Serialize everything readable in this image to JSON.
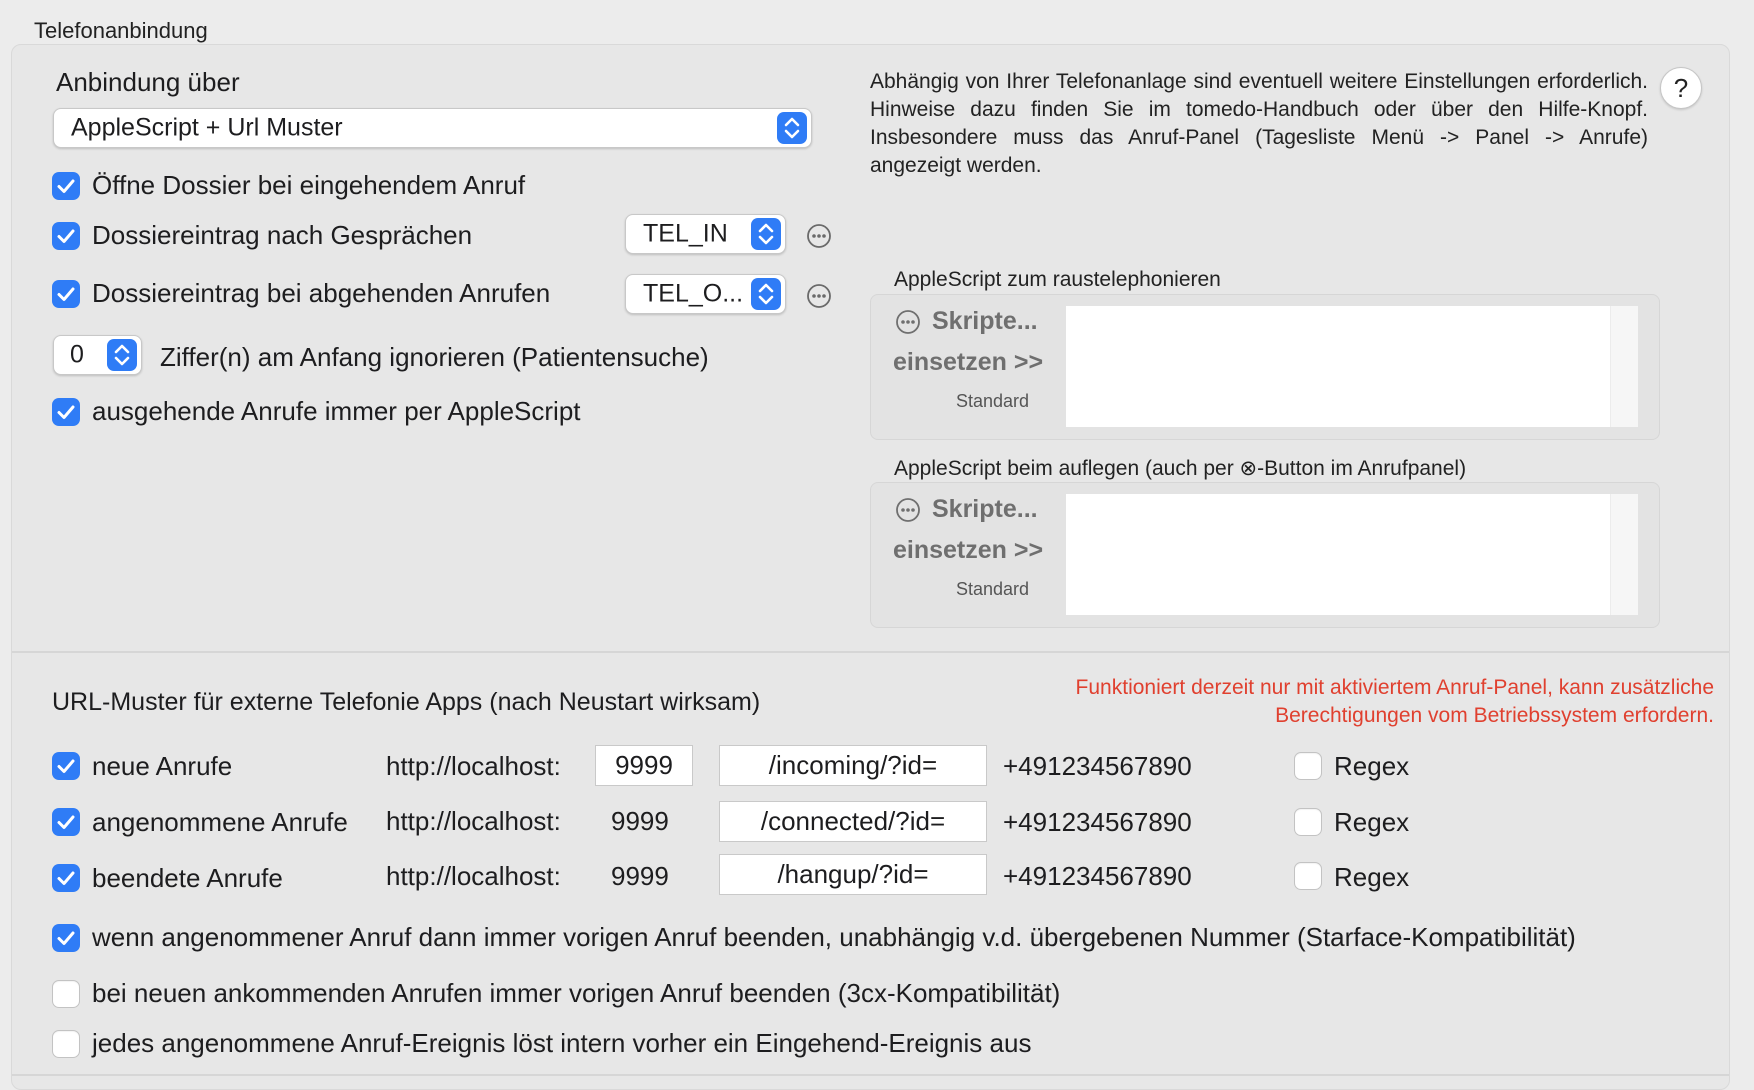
{
  "section_title": "Telefonanbindung",
  "connection": {
    "label": "Anbindung über",
    "selected": "AppleScript + Url Muster"
  },
  "options": {
    "open_dossier": "Öffne Dossier bei eingehendem Anruf",
    "entry_after_call": "Dossiereintrag nach Gesprächen",
    "entry_after_call_value": "TEL_IN",
    "entry_outgoing": "Dossiereintrag bei abgehenden Anrufen",
    "entry_outgoing_value": "TEL_O...",
    "ignore_digits_value": "0",
    "ignore_digits_label": "Ziffer(n) am Anfang ignorieren (Patientensuche)",
    "outgoing_applescript": "ausgehende Anrufe immer per AppleScript"
  },
  "info_text": "Abhängig von Ihrer Telefonanlage sind eventuell weitere Einstellungen erforderlich. Hinweise dazu finden Sie im tomedo-Handbuch oder über den Hilfe-Knopf. Insbesondere muss das Anruf-Panel (Tagesliste Menü -> Panel -> Anrufe) angezeigt werden.",
  "help_label": "?",
  "script_dial": {
    "title": "AppleScript zum raustelephonieren",
    "scripts_button": "Skripte...",
    "insert_button": "einsetzen >>",
    "standard": "Standard"
  },
  "script_hangup": {
    "title": "AppleScript beim auflegen (auch per ⊗-Button im Anrufpanel)",
    "scripts_button": "Skripte...",
    "insert_button": "einsetzen >>",
    "standard": "Standard"
  },
  "url": {
    "heading": "URL-Muster für externe Telefonie Apps (nach Neustart wirksam)",
    "warning": "Funktioniert derzeit nur mit aktiviertem Anruf-Panel, kann zusätzliche Berechtigungen vom Betriebssystem erfordern.",
    "rows": [
      {
        "label": "neue Anrufe",
        "host": "http://localhost:",
        "port": "9999",
        "path": "/incoming/?id=",
        "example": "+491234567890",
        "regex": "Regex"
      },
      {
        "label": "angenommene Anrufe",
        "host": "http://localhost:",
        "port": "9999",
        "path": "/connected/?id=",
        "example": "+491234567890",
        "regex": "Regex"
      },
      {
        "label": "beendete Anrufe",
        "host": "http://localhost:",
        "port": "9999",
        "path": "/hangup/?id=",
        "example": "+491234567890",
        "regex": "Regex"
      }
    ],
    "opt_end_previous": "wenn angenommener Anruf dann immer vorigen Anruf beenden, unabhängig v.d. übergebenen Nummer (Starface-Kompatibilität)",
    "opt_3cx": "bei neuen ankommenden Anrufen immer vorigen Anruf beenden (3cx-Kompatibilität)",
    "opt_incoming_event": "jedes angenommene Anruf-Ereignis löst intern vorher ein Eingehend-Ereignis aus"
  },
  "colors": {
    "accent": "#2f7cf6",
    "warning": "#e0402f"
  }
}
